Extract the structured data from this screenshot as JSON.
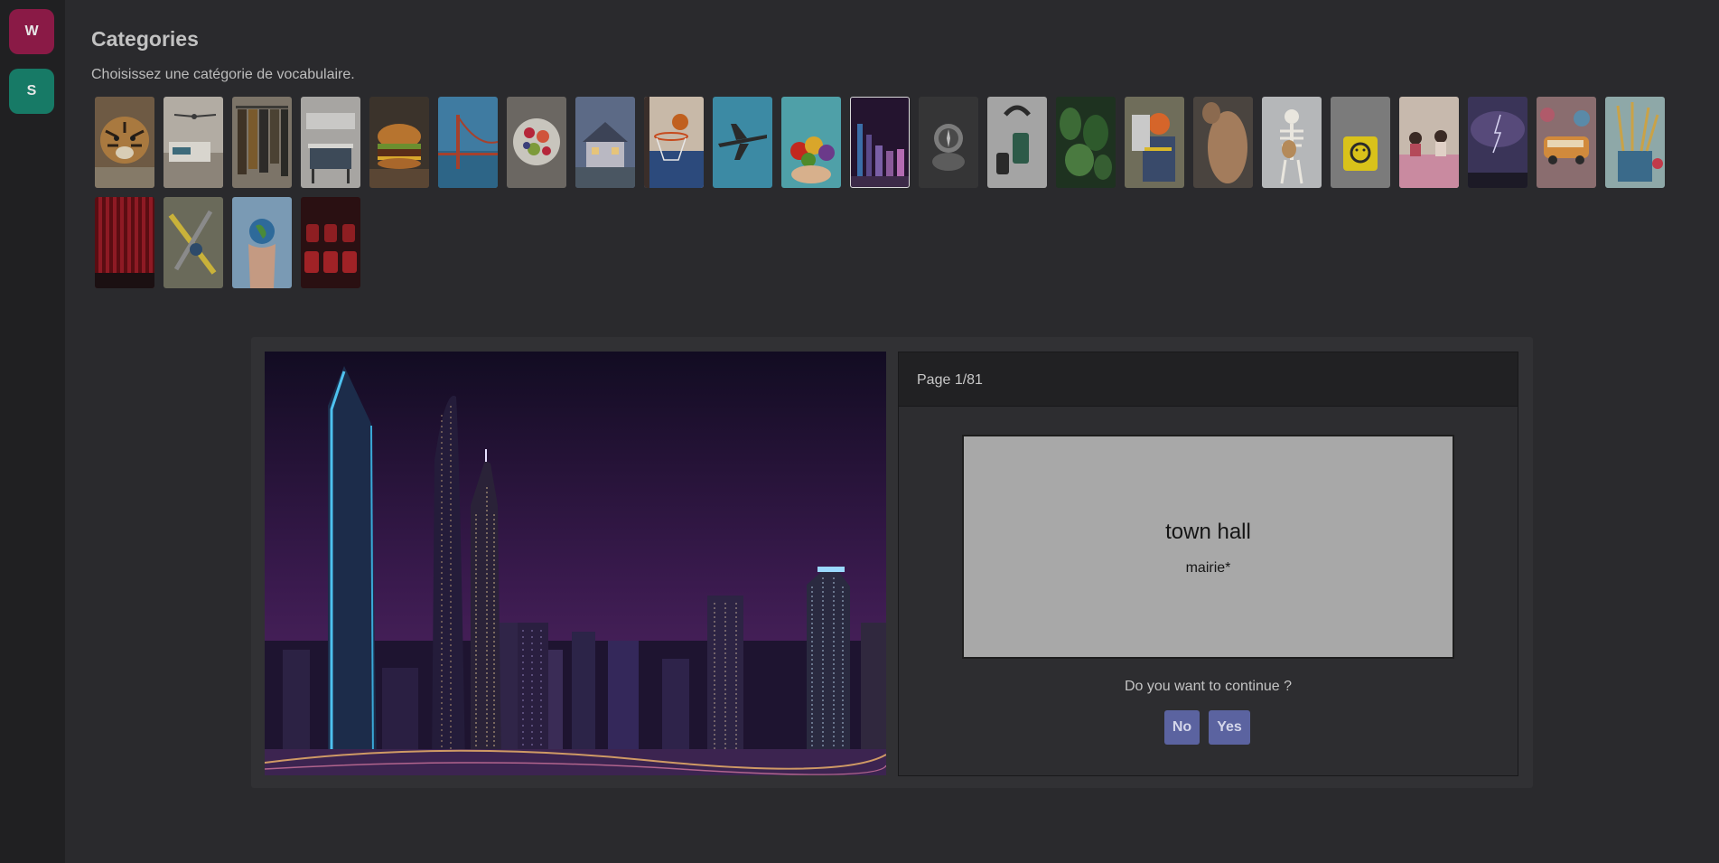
{
  "sidebar": {
    "items": [
      {
        "label": "W",
        "color": "#8a1a46"
      },
      {
        "label": "S",
        "color": "#177a66"
      }
    ]
  },
  "header": {
    "title": "Categories",
    "subtitle": "Choisissez une catégorie de vocabulaire."
  },
  "categories": [
    {
      "name": "tiger",
      "icon": "tiger-image"
    },
    {
      "name": "bedroom",
      "icon": "bedroom-image"
    },
    {
      "name": "clothes",
      "icon": "clothes-image"
    },
    {
      "name": "kitchen",
      "icon": "kitchen-image"
    },
    {
      "name": "burger",
      "icon": "burger-image"
    },
    {
      "name": "bridge",
      "icon": "bridge-image"
    },
    {
      "name": "fruit bowl",
      "icon": "fruit-bowl-image"
    },
    {
      "name": "house",
      "icon": "house-image"
    },
    {
      "name": "basketball",
      "icon": "basketball-image"
    },
    {
      "name": "airplane",
      "icon": "airplane-image"
    },
    {
      "name": "vegetables",
      "icon": "vegetables-image"
    },
    {
      "name": "city",
      "icon": "city-image",
      "selected": true
    },
    {
      "name": "compass",
      "icon": "compass-image"
    },
    {
      "name": "electronics",
      "icon": "electronics-image"
    },
    {
      "name": "plants",
      "icon": "plants-image"
    },
    {
      "name": "worker",
      "icon": "worker-image"
    },
    {
      "name": "body",
      "icon": "body-image"
    },
    {
      "name": "skeleton",
      "icon": "skeleton-image"
    },
    {
      "name": "emoji cube",
      "icon": "emoji-cube-image"
    },
    {
      "name": "classroom",
      "icon": "classroom-image"
    },
    {
      "name": "storm",
      "icon": "storm-image"
    },
    {
      "name": "van",
      "icon": "van-image"
    },
    {
      "name": "paint brushes",
      "icon": "paint-brushes-image"
    },
    {
      "name": "theater curtain",
      "icon": "theater-curtain-image"
    },
    {
      "name": "tools",
      "icon": "tools-image"
    },
    {
      "name": "globe in hand",
      "icon": "globe-image"
    },
    {
      "name": "cinema seats",
      "icon": "cinema-seats-image"
    }
  ],
  "card": {
    "page_label": "Page 1/81",
    "word": "town hall",
    "translation": "mairie*",
    "question": "Do you want to continue ?",
    "no_label": "No",
    "yes_label": "Yes",
    "button_color": "#5b63a0"
  },
  "image": {
    "alt": "city-skyline-image"
  }
}
